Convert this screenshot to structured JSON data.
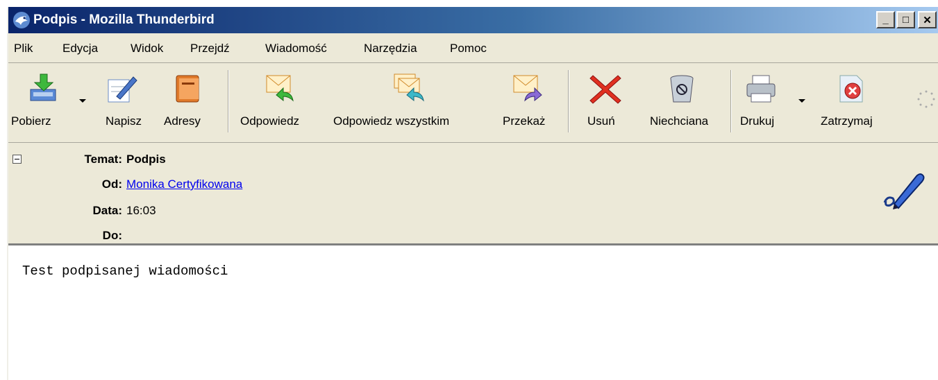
{
  "window": {
    "title": "Podpis - Mozilla Thunderbird",
    "controls": {
      "minimize": "_",
      "maximize": "□",
      "close": "✕"
    }
  },
  "menu": [
    {
      "label": "Plik"
    },
    {
      "label": "Edycja"
    },
    {
      "label": "Widok"
    },
    {
      "label": "Przejdź"
    },
    {
      "label": "Wiadomość"
    },
    {
      "label": "Narzędzia"
    },
    {
      "label": "Pomoc"
    }
  ],
  "toolbar": {
    "get_mail": {
      "label": "Pobierz",
      "icon": "get-mail-icon"
    },
    "write": {
      "label": "Napisz",
      "icon": "write-icon"
    },
    "address_book": {
      "label": "Adresy",
      "icon": "address-book-icon"
    },
    "reply": {
      "label": "Odpowiedz",
      "icon": "reply-icon"
    },
    "reply_all": {
      "label": "Odpowiedz wszystkim",
      "icon": "reply-all-icon"
    },
    "forward": {
      "label": "Przekaż",
      "icon": "forward-icon"
    },
    "delete": {
      "label": "Usuń",
      "icon": "delete-icon"
    },
    "junk": {
      "label": "Niechciana",
      "icon": "junk-icon"
    },
    "print": {
      "label": "Drukuj",
      "icon": "print-icon"
    },
    "stop": {
      "label": "Zatrzymaj",
      "icon": "stop-icon"
    }
  },
  "headers": {
    "subject_label": "Temat:",
    "subject_value": "Podpis",
    "from_label": "Od:",
    "from_value": "Monika Certyfikowana",
    "date_label": "Data:",
    "date_value": "16:03",
    "to_label": "Do:",
    "to_value": ""
  },
  "message": {
    "body": "Test podpisanej wiadomości"
  },
  "colors": {
    "titlebar_start": "#0a246a",
    "titlebar_end": "#a6caf0",
    "chrome": "#ece9d8",
    "link": "#0000ee"
  }
}
